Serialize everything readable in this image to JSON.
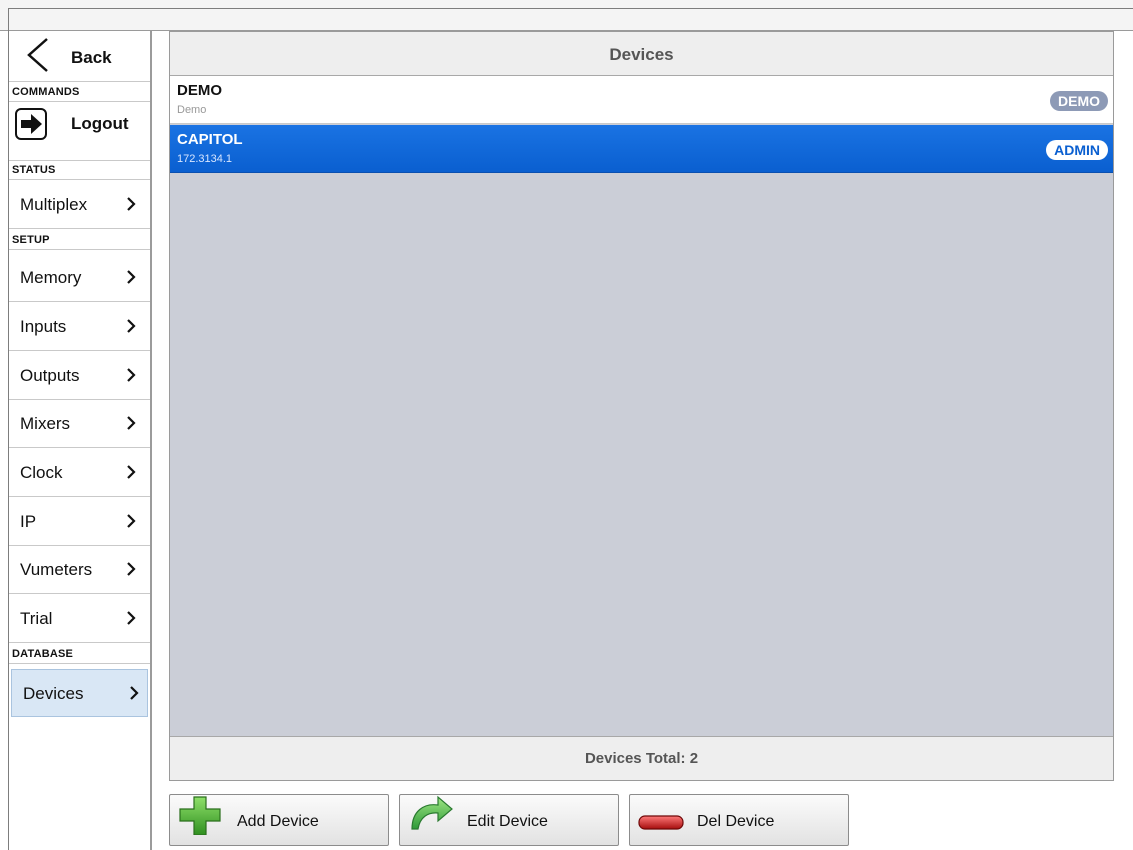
{
  "sidebar": {
    "back_label": "Back",
    "commands_header": "COMMANDS",
    "logout_label": "Logout",
    "status_header": "STATUS",
    "multiplex_label": "Multiplex",
    "setup_header": "SETUP",
    "setup_items": [
      "Memory",
      "Inputs",
      "Outputs",
      "Mixers",
      "Clock",
      "IP",
      "Vumeters",
      "Trial"
    ],
    "database_header": "DATABASE",
    "devices_label": "Devices"
  },
  "main": {
    "title": "Devices",
    "devices": [
      {
        "name": "DEMO",
        "sub": "Demo",
        "badge": "DEMO",
        "selected": false
      },
      {
        "name": "CAPITOL",
        "sub": "172.3134.1",
        "badge": "ADMIN",
        "selected": true
      }
    ],
    "footer": "Devices Total: 2"
  },
  "buttons": {
    "add": "Add Device",
    "edit": "Edit Device",
    "del": "Del Device"
  },
  "colors": {
    "selected_row": "#0a5fd0",
    "panel_bg": "#cbced7",
    "demo_badge": "#8d9ab6"
  },
  "icons": {
    "back": "chevron-left-icon",
    "logout": "logout-arrow-icon",
    "nav_chevron": "chevron-right-icon",
    "add": "green-plus-icon",
    "edit": "green-redo-arrow-icon",
    "del": "red-minus-icon"
  }
}
